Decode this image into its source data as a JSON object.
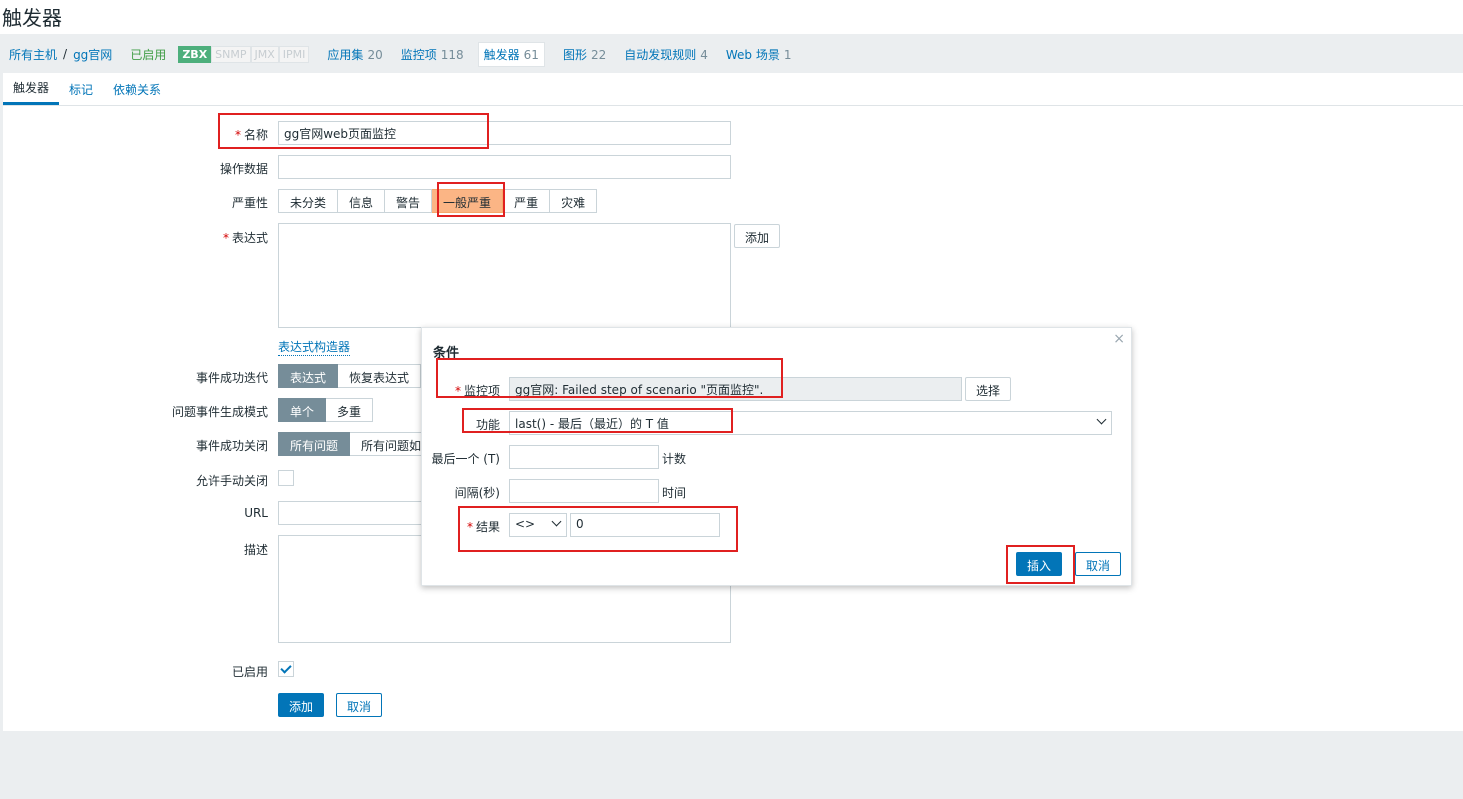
{
  "page_title": "触发器",
  "breadcrumb": {
    "all_hosts": "所有主机",
    "separator": "/",
    "host": "gg官网",
    "status": "已启用"
  },
  "availability": [
    "ZBX",
    "SNMP",
    "JMX",
    "IPMI"
  ],
  "host_nav": [
    {
      "label": "应用集",
      "count": "20"
    },
    {
      "label": "监控项",
      "count": "118"
    },
    {
      "label": "触发器",
      "count": "61",
      "active": true
    },
    {
      "label": "图形",
      "count": "22"
    },
    {
      "label": "自动发现规则",
      "count": "4"
    },
    {
      "label": "Web 场景",
      "count": "1"
    }
  ],
  "tabs": [
    "触发器",
    "标记",
    "依赖关系"
  ],
  "form": {
    "name_label": "名称",
    "name_value": "gg官网web页面监控",
    "opdata_label": "操作数据",
    "severity_label": "严重性",
    "severity_options": [
      "未分类",
      "信息",
      "警告",
      "一般严重",
      "严重",
      "灾难"
    ],
    "expression_label": "表达式",
    "add_button": "添加",
    "expression_builder_link": "表达式构造器",
    "recovery_label": "事件成功迭代",
    "recovery_options": [
      "表达式",
      "恢复表达式"
    ],
    "problem_mode_label": "问题事件生成模式",
    "problem_mode_options": [
      "单个",
      "多重"
    ],
    "ok_close_label": "事件成功关闭",
    "ok_close_options": [
      "所有问题",
      "所有问题如"
    ],
    "manual_close_label": "允许手动关闭",
    "url_label": "URL",
    "description_label": "描述",
    "enabled_label": "已启用",
    "submit_button": "添加",
    "cancel_button": "取消"
  },
  "dialog": {
    "title": "条件",
    "close": "×",
    "item_label": "监控项",
    "item_value": "gg官网: Failed step of scenario \"页面监控\".",
    "select_button": "选择",
    "function_label": "功能",
    "function_value": "last() - 最后（最近）的 T 值",
    "last_label": "最后一个 (T)",
    "last_suffix": "计数",
    "interval_label": "间隔(秒)",
    "interval_suffix": "时间",
    "result_label": "结果",
    "result_operator": "<>",
    "result_value": "0",
    "insert_button": "插入",
    "cancel_button": "取消"
  },
  "colors": {
    "link": "#0275b8",
    "highlight_box": "#e02020",
    "severity_selected": "#fbb585",
    "enabled": "#429e47"
  }
}
